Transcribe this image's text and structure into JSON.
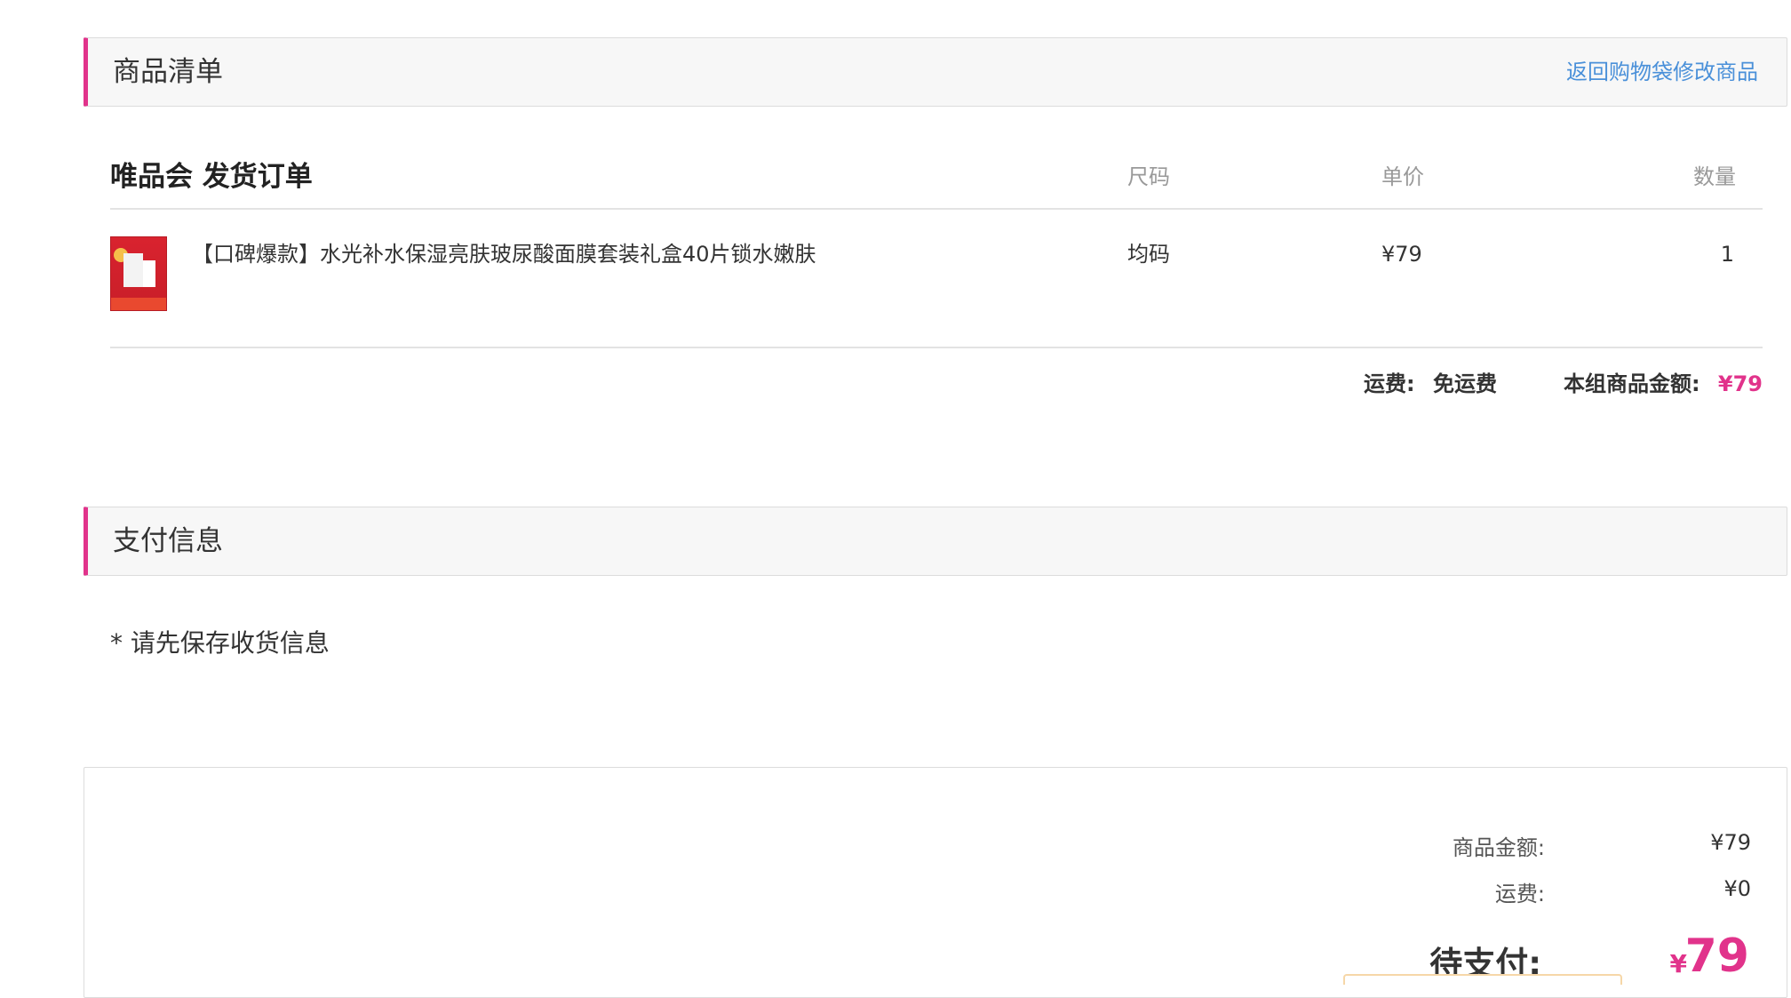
{
  "goods_section": {
    "title": "商品清单",
    "back_link": "返回购物袋修改商品"
  },
  "order": {
    "title": "唯品会 发货订单",
    "columns": {
      "size": "尺码",
      "unit_price": "单价",
      "quantity": "数量"
    },
    "items": [
      {
        "name": "【口碑爆款】水光补水保湿亮肤玻尿酸面膜套装礼盒40片锁水嫩肤",
        "size": "均码",
        "price": "¥79",
        "quantity": "1"
      }
    ],
    "shipping_label": "运费:",
    "shipping_value": "免运费",
    "group_total_label": "本组商品金额:",
    "group_total_value": "¥79"
  },
  "payment_section": {
    "title": "支付信息",
    "note": "* 请先保存收货信息"
  },
  "summary": {
    "goods_amount_label": "商品金额:",
    "goods_amount_value": "¥79",
    "shipping_label": "运费:",
    "shipping_value": "¥0",
    "due_label": "待支付:",
    "due_currency": "¥",
    "due_value": "79"
  },
  "colors": {
    "accent": "#e1338b",
    "link": "#4a90d9"
  }
}
